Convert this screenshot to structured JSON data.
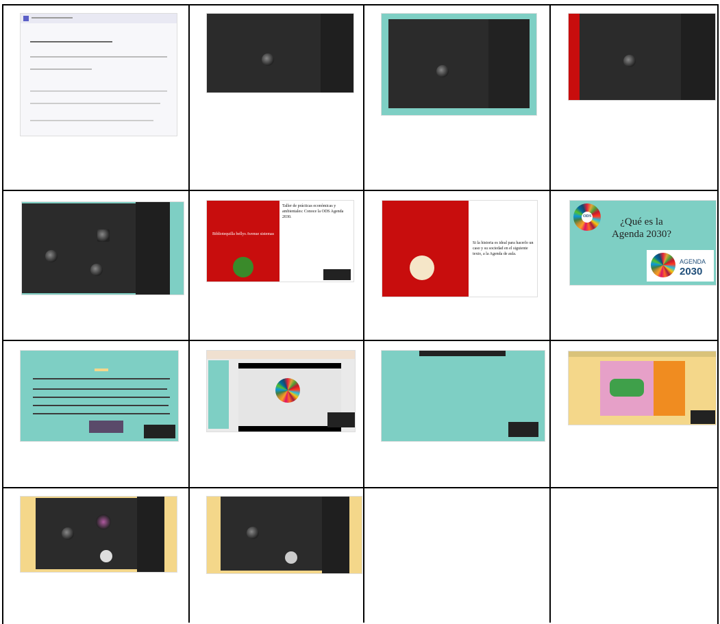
{
  "cells": {
    "c6_title": "Bibliotequilla bellys Avenue sistemas",
    "c6_body": "Taller de prácticas económicas y ambientales: Conoce la ODS Agenda 2030.",
    "c7_body": "Si la historia es ideal para hacerlo un caso y su sociedad en el siguiente texto, a la Agenda de aula.",
    "c8_title": "¿Qué es la Agenda 2030?",
    "c8_logo_word": "AGENDA",
    "c8_logo_year": "2030",
    "c8_badge": "ODS"
  },
  "colors": {
    "teal": "#7ecfc4",
    "red": "#c80d0d",
    "dark": "#2b2b2b",
    "yellow": "#f4d78a"
  }
}
